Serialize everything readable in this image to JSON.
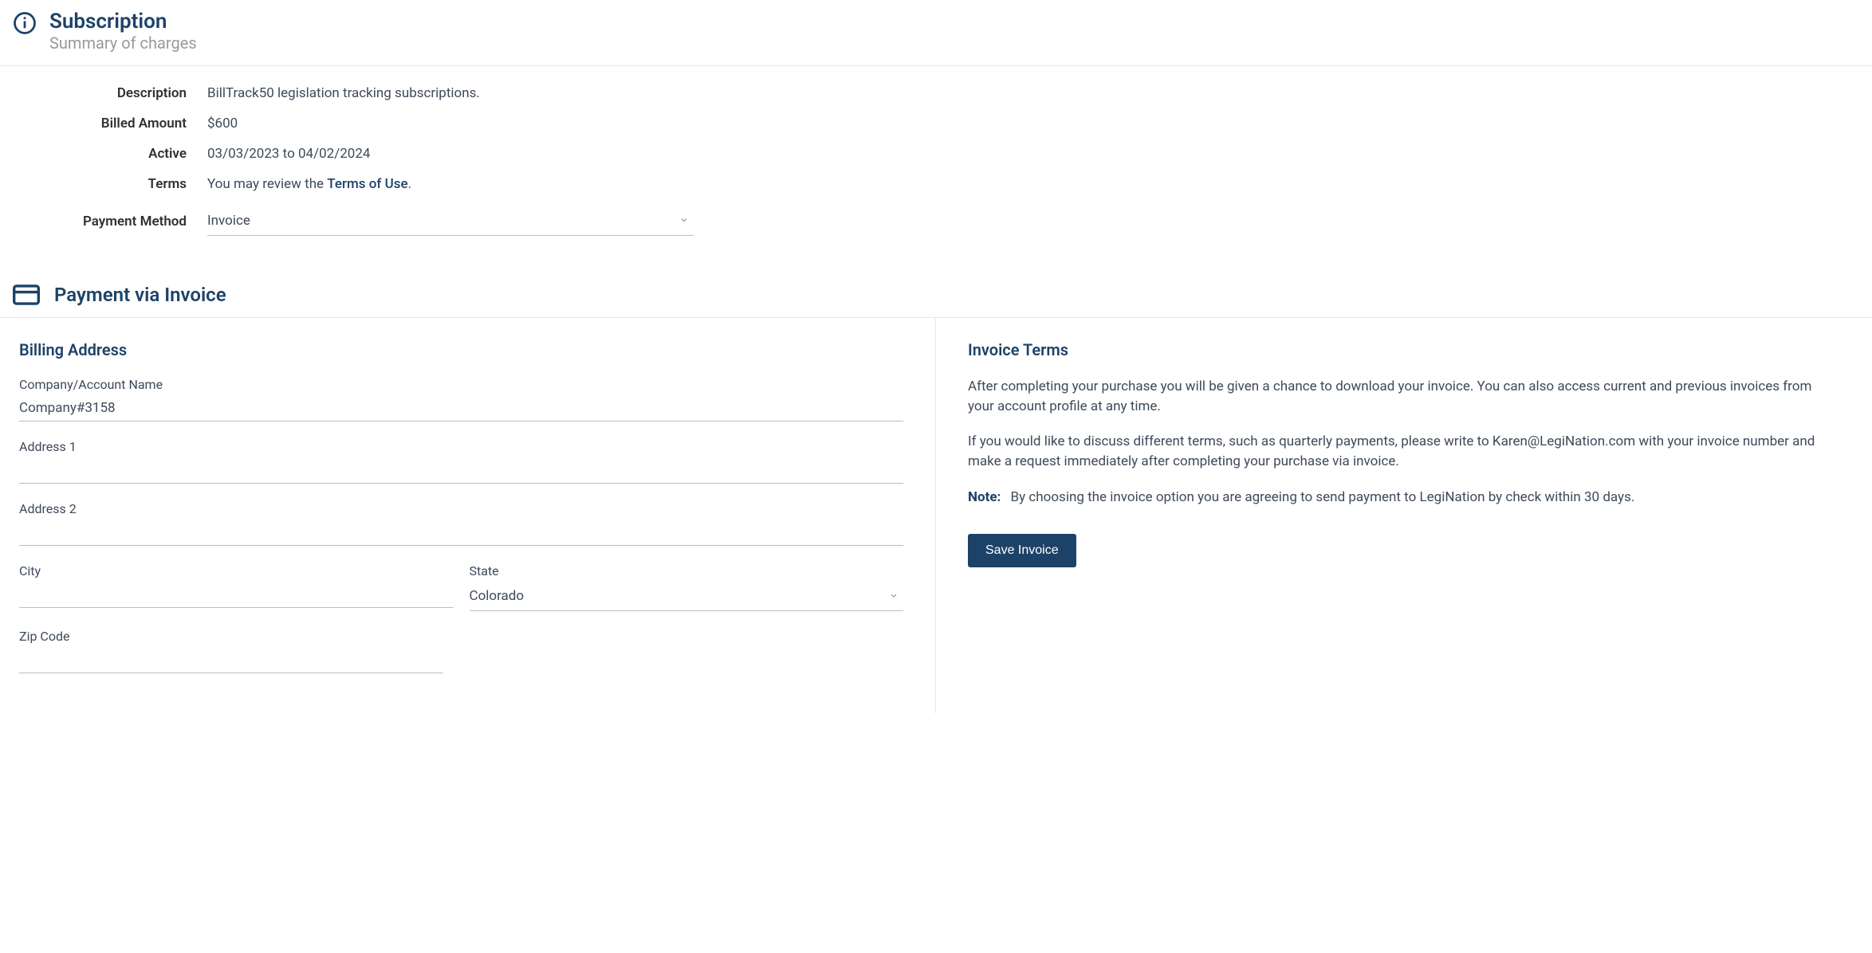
{
  "header": {
    "title": "Subscription",
    "subtitle": "Summary of charges"
  },
  "summary": {
    "description_label": "Description",
    "description_value": "BillTrack50 legislation tracking subscriptions.",
    "billed_label": "Billed Amount",
    "billed_value": "$600",
    "active_label": "Active",
    "active_value": "03/03/2023 to 04/02/2024",
    "terms_label": "Terms",
    "terms_prefix": "You may review the ",
    "terms_link": "Terms of Use",
    "terms_suffix": ".",
    "payment_method_label": "Payment Method",
    "payment_method_value": "Invoice"
  },
  "payment_section": {
    "title": "Payment via Invoice"
  },
  "billing": {
    "title": "Billing Address",
    "company_label": "Company/Account Name",
    "company_value": "Company#3158",
    "address1_label": "Address 1",
    "address1_value": "",
    "address2_label": "Address 2",
    "address2_value": "",
    "city_label": "City",
    "city_value": "",
    "state_label": "State",
    "state_value": "Colorado",
    "zip_label": "Zip Code",
    "zip_value": ""
  },
  "invoice_terms": {
    "title": "Invoice Terms",
    "para1": "After completing your purchase you will be given a chance to download your invoice. You can also access current and previous invoices from your account profile at any time.",
    "para2": "If you would like to discuss different terms, such as quarterly payments, please write to Karen@LegiNation.com with your invoice number and make a request immediately after completing your purchase via invoice.",
    "note_label": "Note:",
    "note_text": "By choosing the invoice option you are agreeing to send payment to LegiNation by check within 30 days.",
    "save_button": "Save Invoice"
  }
}
